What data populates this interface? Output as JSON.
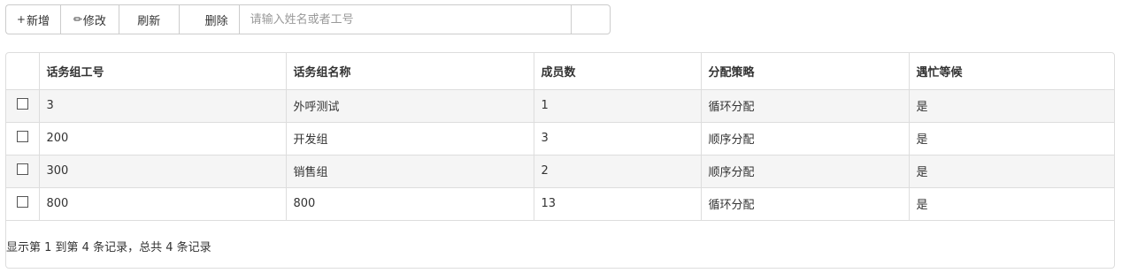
{
  "toolbar": {
    "add_label": "新增",
    "add_glyph": "+",
    "edit_label": "修改",
    "edit_glyph": "✏",
    "refresh_label": "刷新",
    "delete_label": "删除",
    "search_placeholder": "请输入姓名或者工号"
  },
  "table": {
    "columns": [
      "话务组工号",
      "话务组名称",
      "成员数",
      "分配策略",
      "遇忙等候"
    ],
    "rows": [
      [
        "3",
        "外呼测试",
        "1",
        "循环分配",
        "是"
      ],
      [
        "200",
        "开发组",
        "3",
        "顺序分配",
        "是"
      ],
      [
        "300",
        "销售组",
        "2",
        "顺序分配",
        "是"
      ],
      [
        "800",
        "800",
        "13",
        "循环分配",
        "是"
      ]
    ]
  },
  "pagination": {
    "summary": "显示第 1 到第 4 条记录，总共 4 条记录"
  }
}
